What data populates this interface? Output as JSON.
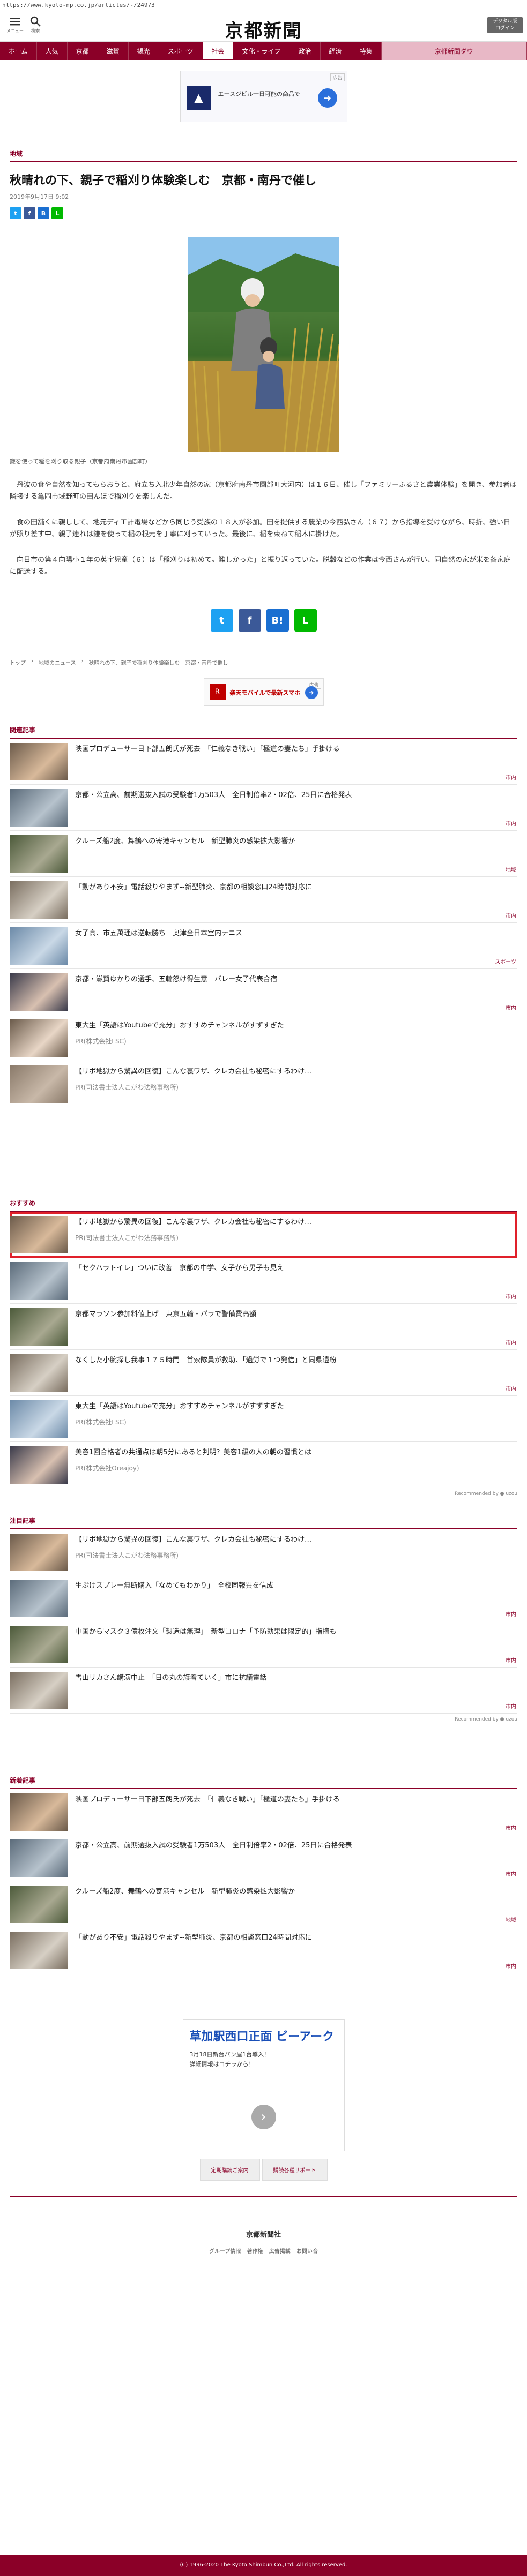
{
  "url": "https://www.kyoto-np.co.jp/articles/-/24973",
  "header": {
    "menu_label": "メニュー",
    "search_label": "検索",
    "logo_text": "京都新聞",
    "digital_line1": "デジタル版",
    "digital_line2": "ログイン"
  },
  "nav": [
    "ホーム",
    "人気",
    "京都",
    "滋賀",
    "観光",
    "スポーツ",
    "社会",
    "文化・ライフ",
    "政治",
    "経済",
    "特集",
    "京都新聞ダウ"
  ],
  "nav_active_index": 6,
  "ad_top": {
    "mark": "広告",
    "text": "エースジビル一日可能の商品で"
  },
  "article": {
    "category": "地域",
    "title": "秋晴れの下、親子で稲刈り体験楽しむ　京都・南丹で催し",
    "date": "2019年9月17日 9:02",
    "caption": "鎌を使って稲を刈り取る親子（京都府南丹市園部町）",
    "paragraphs": [
      "　丹波の食や自然を知ってもらおうと、府立ち入北少年自然の家（京都府南丹市園部町大河内）は１６日、催し「ファミリーふるさと農業体験」を開き、参加者は隣接する亀岡市域野町の田んぼで稲刈りを楽しんだ。",
      "　食の田舗くに親しして、地元ディ工計電場などから同じう受族の１８人が参加。田を提供する農業の今西弘さん（６７）から指導を受けながら、時折、強い日が照り差す中、親子連れは鎌を使って稲の根元を丁寧に刈っていった。最後に、稲を束ねて稲木に掛けた。",
      "　向日市の第４向陽小１年の英宇児童（６）は「稲刈りは初めて。難しかった」と振り返っていた。脱穀などの作業は今西さんが行い、同自然の家が米を各家庭に配送する。"
    ]
  },
  "breadcrumb": [
    "トップ",
    "地域のニュース",
    "秋晴れの下、親子で稲刈り体験楽しむ　京都・南丹で催し"
  ],
  "ad_mid": {
    "mark": "広告",
    "text": "楽天モバイルで最新スマホ"
  },
  "related": {
    "heading": "関連記事",
    "items": [
      {
        "title": "映画プロデューサー日下部五朗氏が死去　「仁義なき戦い」「極道の妻たち」手掛ける",
        "tag": "市内"
      },
      {
        "title": "京都・公立高、前期選抜入試の受験者1万503人　全日制倍率2・02倍、25日に合格発表",
        "tag": "市内"
      },
      {
        "title": "クルーズ船2度、舞鶴への寄港キャンセル　新型肺炎の感染拡大影響か",
        "tag": "地域"
      },
      {
        "title": "「動があり不安」電話殺りやまず--新型肺炎、京都の相談窓口24時間対応に",
        "tag": "市内"
      },
      {
        "title": "女子高、市五萬理は逆転勝ち　奥津全日本室内テニス",
        "tag": "スポーツ"
      },
      {
        "title": "京都・滋賀ゆかりの選手、五輪怒け得生意　バレー女子代表合宿",
        "tag": "市内"
      },
      {
        "title": "東大生「英語はYoutubeで充分」おすすめチャンネルがすずすぎた",
        "src": "PR(株式会社LSC)"
      },
      {
        "title": "【リボ地獄から驚異の回復】こんな裏ワザ、クレカ会社も秘密にするわけ…",
        "src": "PR(司法書士法人こがわ法務事務所)"
      }
    ]
  },
  "recommend": {
    "heading": "おすすめ",
    "items": [
      {
        "title": "【リボ地獄から驚異の回復】こんな裏ワザ、クレカ会社も秘密にするわけ…",
        "src": "PR(司法書士法人こがわ法務事務所)",
        "highlight": true
      },
      {
        "title": "「セクハラトイレ」ついに改善　京都の中学、女子から男子も見え",
        "tag": "市内"
      },
      {
        "title": "京都マラソン参加料値上げ　東京五輪・パラで警備費高額",
        "tag": "市内"
      },
      {
        "title": "なくした小腕探し我事１７５時間　首索隊員が救助、「過労で１つ発信」と同県遺紛",
        "tag": "市内"
      },
      {
        "title": "東大生「英語はYoutubeで充分」おすすめチャンネルがすずすぎた",
        "src": "PR(株式会社LSC)"
      },
      {
        "title": "美容1回合格者の共通点は朝5分にあると判明？美容1級の人の朝の習慣とは",
        "src": "PR(株式会社Oreajoy)"
      }
    ],
    "powered": "Recommended by ● uzou"
  },
  "attention": {
    "heading": "注目記事",
    "items": [
      {
        "title": "【リボ地獄から驚異の回復】こんな裏ワザ、クレカ会社も秘密にするわけ…",
        "src": "PR(司法書士法人こがわ法務事務所)"
      },
      {
        "title": "生ぷけスプレー無断購入「なめてもわかり」　全校同報異を信成",
        "tag": "市内"
      },
      {
        "title": "中国からマスク３億枚注文「製造は無理」　新型コロナ「予防効果は限定的」指摘も",
        "tag": "市内"
      },
      {
        "title": "雪山リカさん講演中止　「日の丸の旗着ていく」市に抗議電話",
        "tag": "市内"
      }
    ],
    "powered": "Recommended by ● uzou"
  },
  "latest": {
    "heading": "新着記事",
    "items": [
      {
        "title": "映画プロデューサー日下部五朗氏が死去　「仁義なき戦い」「極道の妻たち」手掛ける",
        "tag": "市内"
      },
      {
        "title": "京都・公立高、前期選抜入試の受験者1万503人　全日制倍率2・02倍、25日に合格発表",
        "tag": "市内"
      },
      {
        "title": "クルーズ船2度、舞鶴への寄港キャンセル　新型肺炎の感染拡大影響か",
        "tag": "地域"
      },
      {
        "title": "「動があり不安」電話殺りやまず--新型肺炎、京都の相談窓口24時間対応に",
        "tag": "市内"
      }
    ]
  },
  "big_ad": {
    "headline": "草加駅西口正面 ビーアーク",
    "sub1": "3月18日新台パン屋1台導入！",
    "sub2": "詳細情報はコチラから！",
    "arrow": "›"
  },
  "footer_buttons": [
    "定期購読ご案内",
    "購読各種サポート"
  ],
  "footer_logo": "京都新聞社",
  "footer_links": [
    "グループ情報",
    "著作権",
    "広告掲載",
    "お問い合"
  ],
  "copyright": "(C) 1996-2020 The Kyoto Shimbun Co.,Ltd. All rights reserved."
}
